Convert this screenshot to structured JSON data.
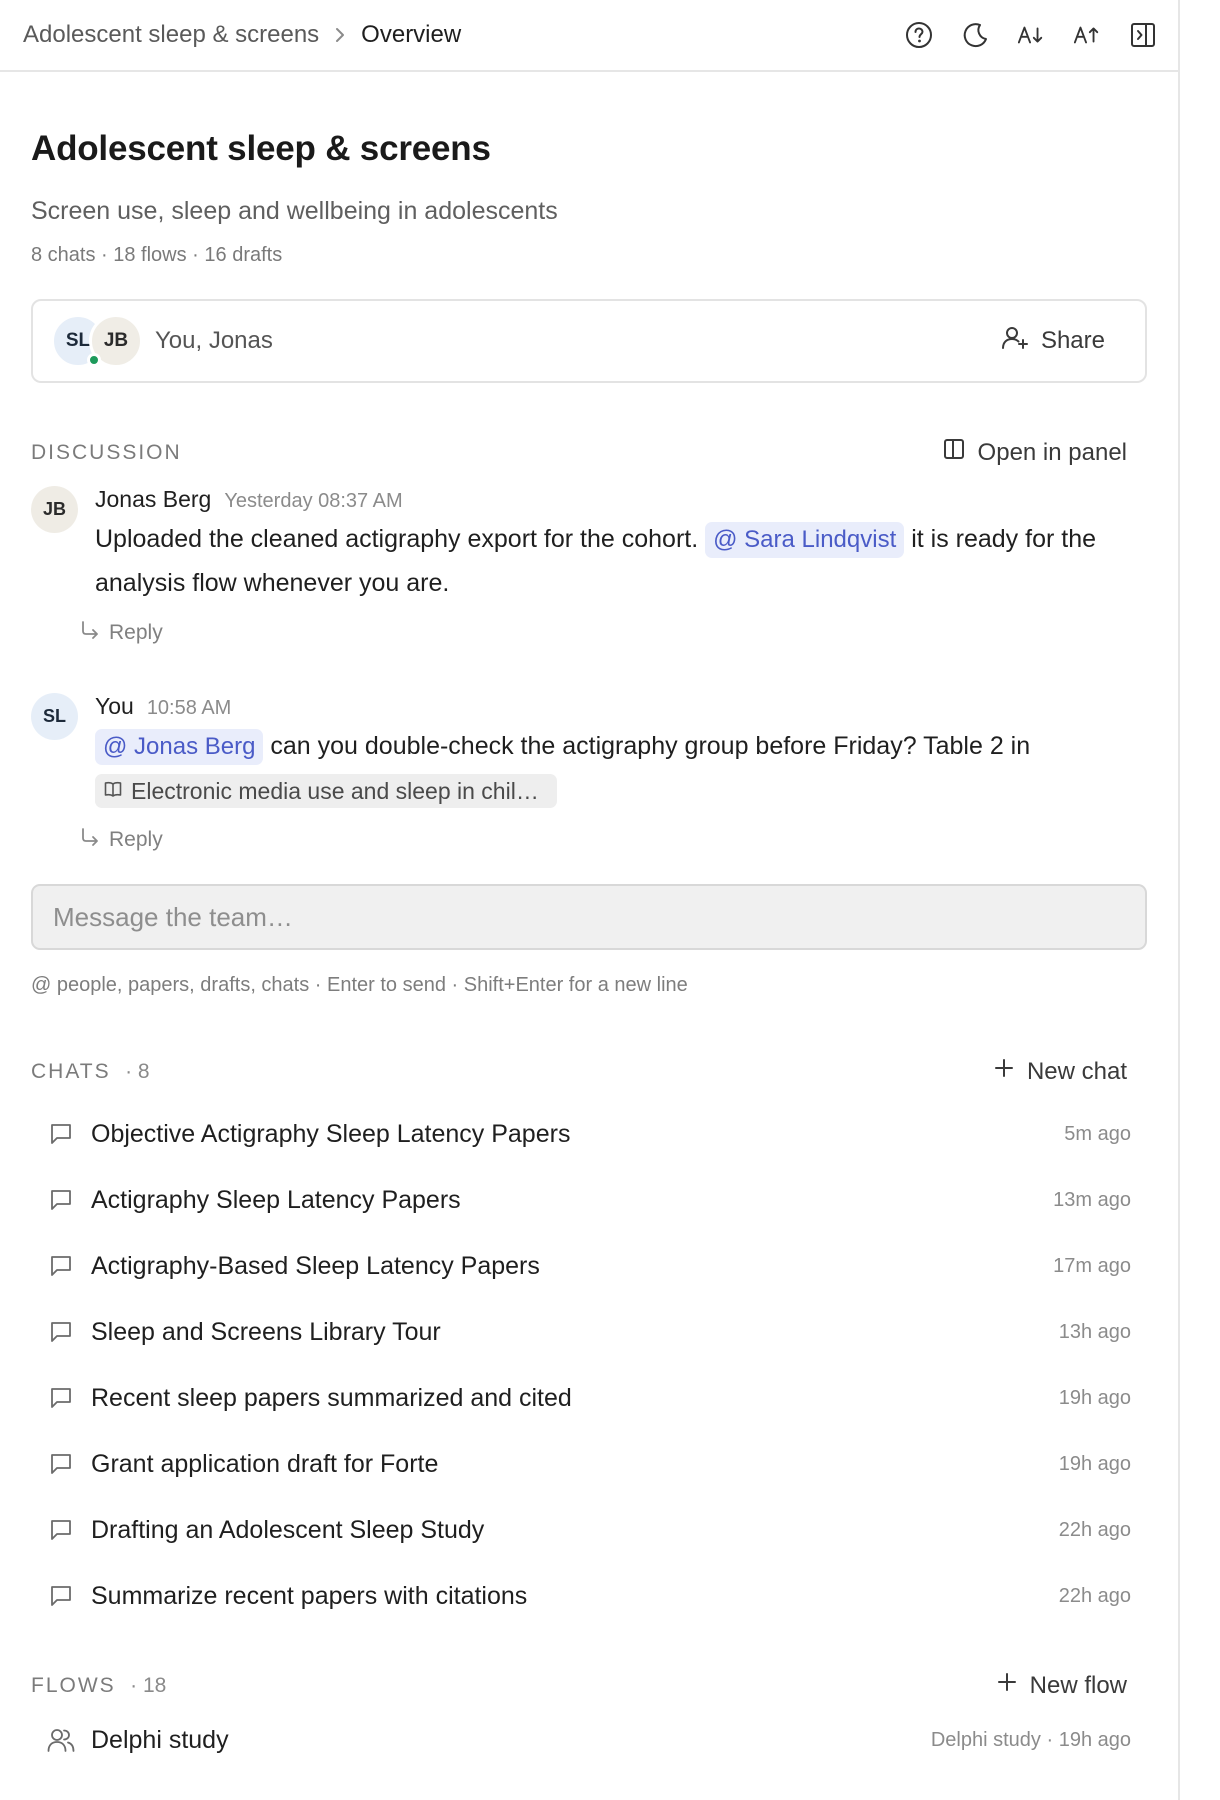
{
  "breadcrumb": {
    "parent": "Adolescent sleep & screens",
    "current": "Overview"
  },
  "topbar_icons": [
    "help-circle-icon",
    "moon-icon",
    "font-size-decrease-icon",
    "font-size-increase-icon",
    "panel-right-icon"
  ],
  "project": {
    "title": "Adolescent sleep & screens",
    "subtitle": "Screen use, sleep and wellbeing in adolescents",
    "stats": "8 chats · 18 flows · 16 drafts"
  },
  "collaborators": {
    "avatars": [
      "SL",
      "JB"
    ],
    "names": "You, Jonas",
    "share_label": "Share"
  },
  "discussion": {
    "label": "DISCUSSION",
    "open_panel_label": "Open in panel",
    "messages": [
      {
        "initials": "JB",
        "author": "Jonas Berg",
        "time": "Yesterday 08:37 AM",
        "text_before": "Uploaded the cleaned actigraphy export for the cohort.",
        "mention": "@ Sara Lindqvist",
        "text_after": "it is ready for the analysis flow whenever you are.",
        "reply_label": "Reply"
      },
      {
        "initials": "SL",
        "author": "You",
        "time": "10:58 AM",
        "mention": "@ Jonas Berg",
        "text_after": "can you double-check the actigraphy group before Friday? Table 2 in",
        "paper": "Electronic media use and sleep in chil…",
        "reply_label": "Reply"
      }
    ],
    "composer_placeholder": "Message the team…",
    "composer_hint": "@ people, papers, drafts, chats · Enter to send · Shift+Enter for a new line"
  },
  "chats": {
    "label": "CHATS",
    "count": "· 8",
    "new_label": "New chat",
    "items": [
      {
        "title": "Objective Actigraphy Sleep Latency Papers",
        "time": "5m ago"
      },
      {
        "title": "Actigraphy Sleep Latency Papers",
        "time": "13m ago"
      },
      {
        "title": "Actigraphy-Based Sleep Latency Papers",
        "time": "17m ago"
      },
      {
        "title": "Sleep and Screens Library Tour",
        "time": "13h ago"
      },
      {
        "title": "Recent sleep papers summarized and cited",
        "time": "19h ago"
      },
      {
        "title": "Grant application draft for Forte",
        "time": "19h ago"
      },
      {
        "title": "Drafting an Adolescent Sleep Study",
        "time": "22h ago"
      },
      {
        "title": "Summarize recent papers with citations",
        "time": "22h ago"
      }
    ]
  },
  "flows": {
    "label": "FLOWS",
    "count": "· 18",
    "new_label": "New flow",
    "items": [
      {
        "title": "Delphi study",
        "time": "Delphi study · 19h ago"
      }
    ]
  },
  "colors": {
    "mention_bg": "#e9edfb",
    "mention_text": "#4a5bc7",
    "online": "#1d9a5b"
  }
}
